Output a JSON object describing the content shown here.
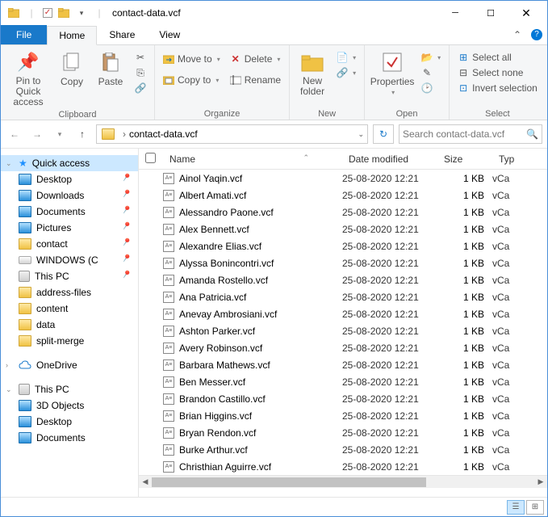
{
  "title": "contact-data.vcf",
  "tabs": {
    "file": "File",
    "home": "Home",
    "share": "Share",
    "view": "View"
  },
  "ribbon": {
    "clipboard": {
      "pin": "Pin to Quick\naccess",
      "copy": "Copy",
      "paste": "Paste",
      "label": "Clipboard"
    },
    "organize": {
      "moveto": "Move to",
      "copyto": "Copy to",
      "delete": "Delete",
      "rename": "Rename",
      "label": "Organize"
    },
    "new": {
      "newfolder": "New\nfolder",
      "label": "New"
    },
    "open": {
      "properties": "Properties",
      "label": "Open"
    },
    "select": {
      "all": "Select all",
      "none": "Select none",
      "invert": "Invert selection",
      "label": "Select"
    }
  },
  "breadcrumb": "contact-data.vcf",
  "search_placeholder": "Search contact-data.vcf",
  "nav": [
    {
      "label": "Quick access",
      "kind": "star",
      "exp": "v",
      "sel": true,
      "pin": false
    },
    {
      "label": "Desktop",
      "kind": "blue",
      "pin": true
    },
    {
      "label": "Downloads",
      "kind": "blue",
      "pin": true
    },
    {
      "label": "Documents",
      "kind": "blue",
      "pin": true
    },
    {
      "label": "Pictures",
      "kind": "blue",
      "pin": true
    },
    {
      "label": "contact",
      "kind": "folder",
      "pin": true
    },
    {
      "label": "WINDOWS (C",
      "kind": "drivewin",
      "pin": true
    },
    {
      "label": "This PC",
      "kind": "pc",
      "pin": true
    },
    {
      "label": "address-files",
      "kind": "folder",
      "pin": false
    },
    {
      "label": "content",
      "kind": "folder",
      "pin": false
    },
    {
      "label": "data",
      "kind": "folder",
      "pin": false
    },
    {
      "label": "split-merge",
      "kind": "folder",
      "pin": false
    },
    {
      "label": "",
      "kind": "spacer",
      "pin": false
    },
    {
      "label": "OneDrive",
      "kind": "cloud",
      "exp": ">",
      "pin": false
    },
    {
      "label": "",
      "kind": "spacer",
      "pin": false
    },
    {
      "label": "This PC",
      "kind": "pc",
      "exp": "v",
      "pin": false
    },
    {
      "label": "3D Objects",
      "kind": "blue",
      "pin": false
    },
    {
      "label": "Desktop",
      "kind": "blue",
      "pin": false
    },
    {
      "label": "Documents",
      "kind": "blue",
      "pin": false
    }
  ],
  "columns": {
    "name": "Name",
    "date": "Date modified",
    "size": "Size",
    "type": "Typ"
  },
  "files": [
    {
      "name": "Ainol Yaqin.vcf",
      "date": "25-08-2020 12:21",
      "size": "1 KB",
      "type": "vCa"
    },
    {
      "name": "Albert Amati.vcf",
      "date": "25-08-2020 12:21",
      "size": "1 KB",
      "type": "vCa"
    },
    {
      "name": "Alessandro Paone.vcf",
      "date": "25-08-2020 12:21",
      "size": "1 KB",
      "type": "vCa"
    },
    {
      "name": "Alex Bennett.vcf",
      "date": "25-08-2020 12:21",
      "size": "1 KB",
      "type": "vCa"
    },
    {
      "name": "Alexandre Elias.vcf",
      "date": "25-08-2020 12:21",
      "size": "1 KB",
      "type": "vCa"
    },
    {
      "name": "Alyssa Bonincontri.vcf",
      "date": "25-08-2020 12:21",
      "size": "1 KB",
      "type": "vCa"
    },
    {
      "name": "Amanda Rostello.vcf",
      "date": "25-08-2020 12:21",
      "size": "1 KB",
      "type": "vCa"
    },
    {
      "name": "Ana Patricia.vcf",
      "date": "25-08-2020 12:21",
      "size": "1 KB",
      "type": "vCa"
    },
    {
      "name": "Anevay Ambrosiani.vcf",
      "date": "25-08-2020 12:21",
      "size": "1 KB",
      "type": "vCa"
    },
    {
      "name": "Ashton Parker.vcf",
      "date": "25-08-2020 12:21",
      "size": "1 KB",
      "type": "vCa"
    },
    {
      "name": "Avery Robinson.vcf",
      "date": "25-08-2020 12:21",
      "size": "1 KB",
      "type": "vCa"
    },
    {
      "name": "Barbara Mathews.vcf",
      "date": "25-08-2020 12:21",
      "size": "1 KB",
      "type": "vCa"
    },
    {
      "name": "Ben Messer.vcf",
      "date": "25-08-2020 12:21",
      "size": "1 KB",
      "type": "vCa"
    },
    {
      "name": "Brandon Castillo.vcf",
      "date": "25-08-2020 12:21",
      "size": "1 KB",
      "type": "vCa"
    },
    {
      "name": "Brian Higgins.vcf",
      "date": "25-08-2020 12:21",
      "size": "1 KB",
      "type": "vCa"
    },
    {
      "name": "Bryan Rendon.vcf",
      "date": "25-08-2020 12:21",
      "size": "1 KB",
      "type": "vCa"
    },
    {
      "name": "Burke Arthur.vcf",
      "date": "25-08-2020 12:21",
      "size": "1 KB",
      "type": "vCa"
    },
    {
      "name": "Christhian Aguirre.vcf",
      "date": "25-08-2020 12:21",
      "size": "1 KB",
      "type": "vCa"
    }
  ]
}
